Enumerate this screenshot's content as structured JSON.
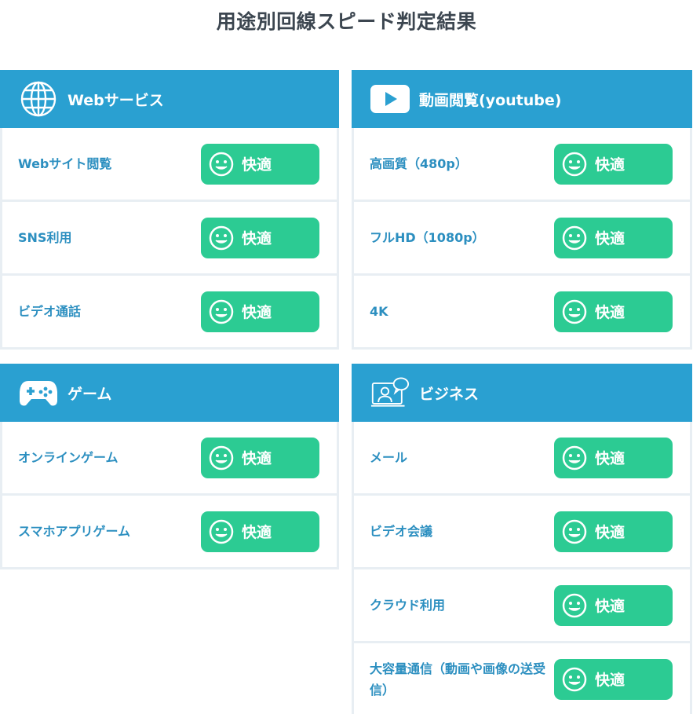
{
  "title": "用途別回線スピード判定結果",
  "colors": {
    "header": "#2aa0d1",
    "badge": "#2ccb93",
    "label": "#2c8fc0",
    "border": "#e8eef3"
  },
  "sections": [
    {
      "title": "Webサービス",
      "icon": "globe-icon",
      "rows": [
        {
          "label": "Webサイト閲覧",
          "status": "快適"
        },
        {
          "label": "SNS利用",
          "status": "快適"
        },
        {
          "label": "ビデオ通話",
          "status": "快適"
        }
      ]
    },
    {
      "title": "動画閲覧(youtube)",
      "icon": "play-icon",
      "rows": [
        {
          "label": "高画質（480p）",
          "status": "快適"
        },
        {
          "label": "フルHD（1080p）",
          "status": "快適"
        },
        {
          "label": "4K",
          "status": "快適"
        }
      ]
    },
    {
      "title": "ゲーム",
      "icon": "gamepad-icon",
      "rows": [
        {
          "label": "オンラインゲーム",
          "status": "快適"
        },
        {
          "label": "スマホアプリゲーム",
          "status": "快適"
        }
      ]
    },
    {
      "title": "ビジネス",
      "icon": "web-meeting-icon",
      "rows": [
        {
          "label": "メール",
          "status": "快適"
        },
        {
          "label": "ビデオ会議",
          "status": "快適"
        },
        {
          "label": "クラウド利用",
          "status": "快適"
        },
        {
          "label": "大容量通信（動画や画像の送受信）",
          "status": "快適"
        }
      ]
    }
  ]
}
